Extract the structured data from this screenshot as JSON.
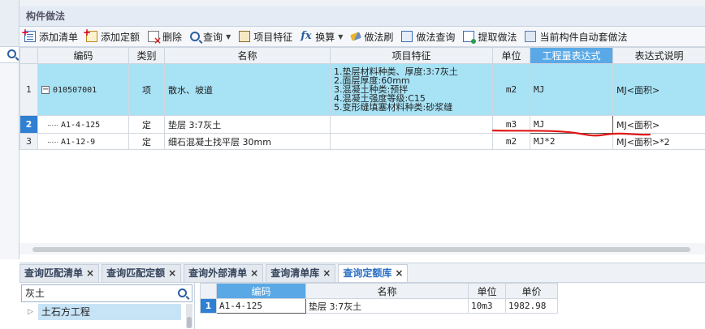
{
  "panel": {
    "title": "构件做法"
  },
  "toolbar": [
    {
      "label": "添加清单",
      "icon": "add-list-icon",
      "ico": "ico-list",
      "caret": false
    },
    {
      "label": "添加定额",
      "icon": "add-quota-icon",
      "ico": "ico-quota",
      "caret": false
    },
    {
      "label": "删除",
      "icon": "delete-icon",
      "ico": "ico-del",
      "caret": false
    },
    {
      "label": "查询",
      "icon": "query-icon",
      "ico": "ico-query",
      "caret": true
    },
    {
      "label": "项目特征",
      "icon": "feature-icon",
      "ico": "ico-feature",
      "caret": false
    },
    {
      "label": "换算",
      "icon": "fx-icon",
      "ico": "ico-fx",
      "glyph": "fx",
      "caret": true
    },
    {
      "label": "做法刷",
      "icon": "brush-icon",
      "ico": "ico-brush",
      "caret": false
    },
    {
      "label": "做法查询",
      "icon": "method-query-icon",
      "ico": "ico-method",
      "caret": false
    },
    {
      "label": "提取做法",
      "icon": "extract-icon",
      "ico": "ico-extract",
      "caret": false
    },
    {
      "label": "当前构件自动套做法",
      "icon": "auto-apply-icon",
      "ico": "ico-auto",
      "caret": false
    }
  ],
  "grid": {
    "headers": {
      "code": "编码",
      "type": "类别",
      "name": "名称",
      "features": "项目特征",
      "unit": "单位",
      "expr": "工程量表达式",
      "desc": "表达式说明"
    },
    "rows": [
      {
        "num": "1",
        "expander": "−",
        "code": "010507001",
        "type": "项",
        "name": "散水、坡道",
        "features": [
          "1.垫层材料种类、厚度:3:7灰土",
          "2.面层厚度:60mm",
          "3.混凝土种类:预拌",
          "4.混凝土强度等级:C15",
          "5.变形缝填塞材料种类:砂浆缝"
        ],
        "unit": "m2",
        "expr": "MJ",
        "desc": "MJ<面积>"
      },
      {
        "num": "2",
        "code": "A1-4-125",
        "type": "定",
        "name": "垫层 3:7灰土",
        "unit": "m3",
        "expr": "MJ",
        "desc": "MJ<面积>"
      },
      {
        "num": "3",
        "code": "A1-12-9",
        "type": "定",
        "name": "细石混凝土找平层 30mm",
        "unit": "m2",
        "expr": "MJ*2",
        "desc": "MJ<面积>*2"
      }
    ]
  },
  "bottom_tabs": [
    {
      "label": "查询匹配清单",
      "close": "×"
    },
    {
      "label": "查询匹配定额",
      "close": "×"
    },
    {
      "label": "查询外部清单",
      "close": "×"
    },
    {
      "label": "查询清单库",
      "close": "×"
    },
    {
      "label": "查询定额库",
      "close": "×",
      "active": true
    }
  ],
  "library": {
    "search_value": "灰土",
    "tree_item": "土石方工程",
    "headers": {
      "code": "编码",
      "name": "名称",
      "unit": "单位",
      "price": "单价"
    },
    "rows": [
      {
        "num": "1",
        "code": "A1-4-125",
        "name": "垫层 3:7灰土",
        "unit": "10m3",
        "price": "1982.98"
      }
    ]
  },
  "colors": {
    "highlight_row": "#a7e2f5",
    "active_header": "#5aa9e6",
    "selected_rownum": "#2f7fd3",
    "annotation_red": "#e01818"
  }
}
